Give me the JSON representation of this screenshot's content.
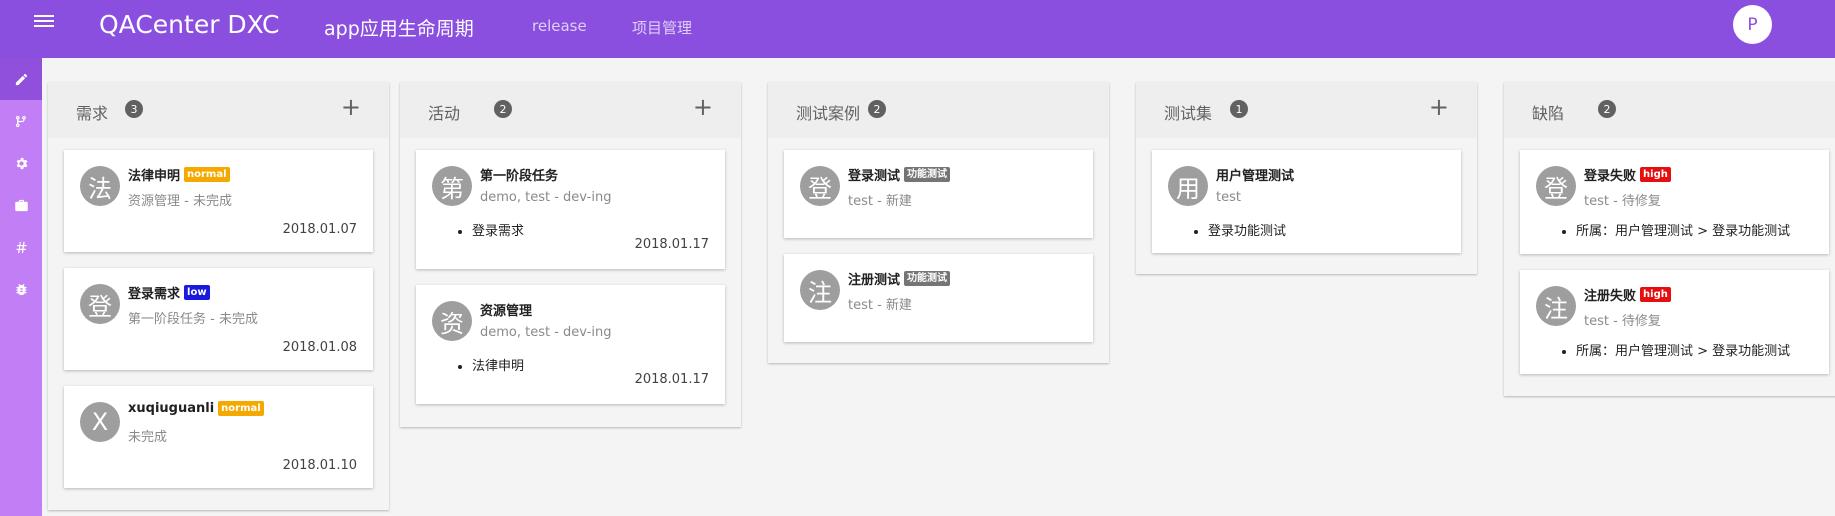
{
  "header": {
    "app_title": "QACenter DXC",
    "page_title": "app应用生命周期",
    "nav": [
      "release",
      "项目管理"
    ],
    "user_initial": "P",
    "color": "#8b4fe0"
  },
  "sidebar": {
    "items": [
      {
        "icon": "pencil-icon",
        "active": true
      },
      {
        "icon": "merge-icon"
      },
      {
        "icon": "gear-icon"
      },
      {
        "icon": "briefcase-icon"
      },
      {
        "icon": "hash-icon"
      },
      {
        "icon": "bug-icon"
      }
    ]
  },
  "columns": [
    {
      "title": "需求",
      "count": "3",
      "has_add": true,
      "cards": [
        {
          "avatar": "法",
          "title": "法律申明",
          "badge": "normal",
          "subtitle": "资源管理 - 未完成",
          "date": "2018.01.07"
        },
        {
          "avatar": "登",
          "title": "登录需求",
          "badge": "low",
          "subtitle": "第一阶段任务 - 未完成",
          "date": "2018.01.08"
        },
        {
          "avatar": "X",
          "title": "xuqiuguanli",
          "badge": "normal",
          "subtitle": "未完成",
          "date": "2018.01.10"
        }
      ]
    },
    {
      "title": "活动",
      "count": "2",
      "has_add": true,
      "cards": [
        {
          "avatar": "第",
          "title": "第一阶段任务",
          "subtitle": "demo, test - dev-ing",
          "bullet": "登录需求",
          "date": "2018.01.17"
        },
        {
          "avatar": "资",
          "title": "资源管理",
          "subtitle": "demo, test - dev-ing",
          "bullet": "法律申明",
          "date": "2018.01.17"
        }
      ]
    },
    {
      "title": "测试案例",
      "count": "2",
      "has_add": false,
      "cards": [
        {
          "avatar": "登",
          "title": "登录测试",
          "badge": "功能测试",
          "subtitle": "test - 新建"
        },
        {
          "avatar": "注",
          "title": "注册测试",
          "badge": "功能测试",
          "subtitle": "test - 新建"
        }
      ]
    },
    {
      "title": "测试集",
      "count": "1",
      "has_add": true,
      "cards": [
        {
          "avatar": "用",
          "title": "用户管理测试",
          "subtitle": "test",
          "bullet": "登录功能测试"
        }
      ]
    },
    {
      "title": "缺陷",
      "count": "2",
      "has_add": false,
      "cards": [
        {
          "avatar": "登",
          "title": "登录失败",
          "badge": "high",
          "subtitle": "test - 待修复",
          "bullet": "所属：用户管理测试 > 登录功能测试"
        },
        {
          "avatar": "注",
          "title": "注册失败",
          "badge": "high",
          "subtitle": "test - 待修复",
          "bullet": "所属：用户管理测试 > 登录功能测试"
        }
      ]
    }
  ]
}
